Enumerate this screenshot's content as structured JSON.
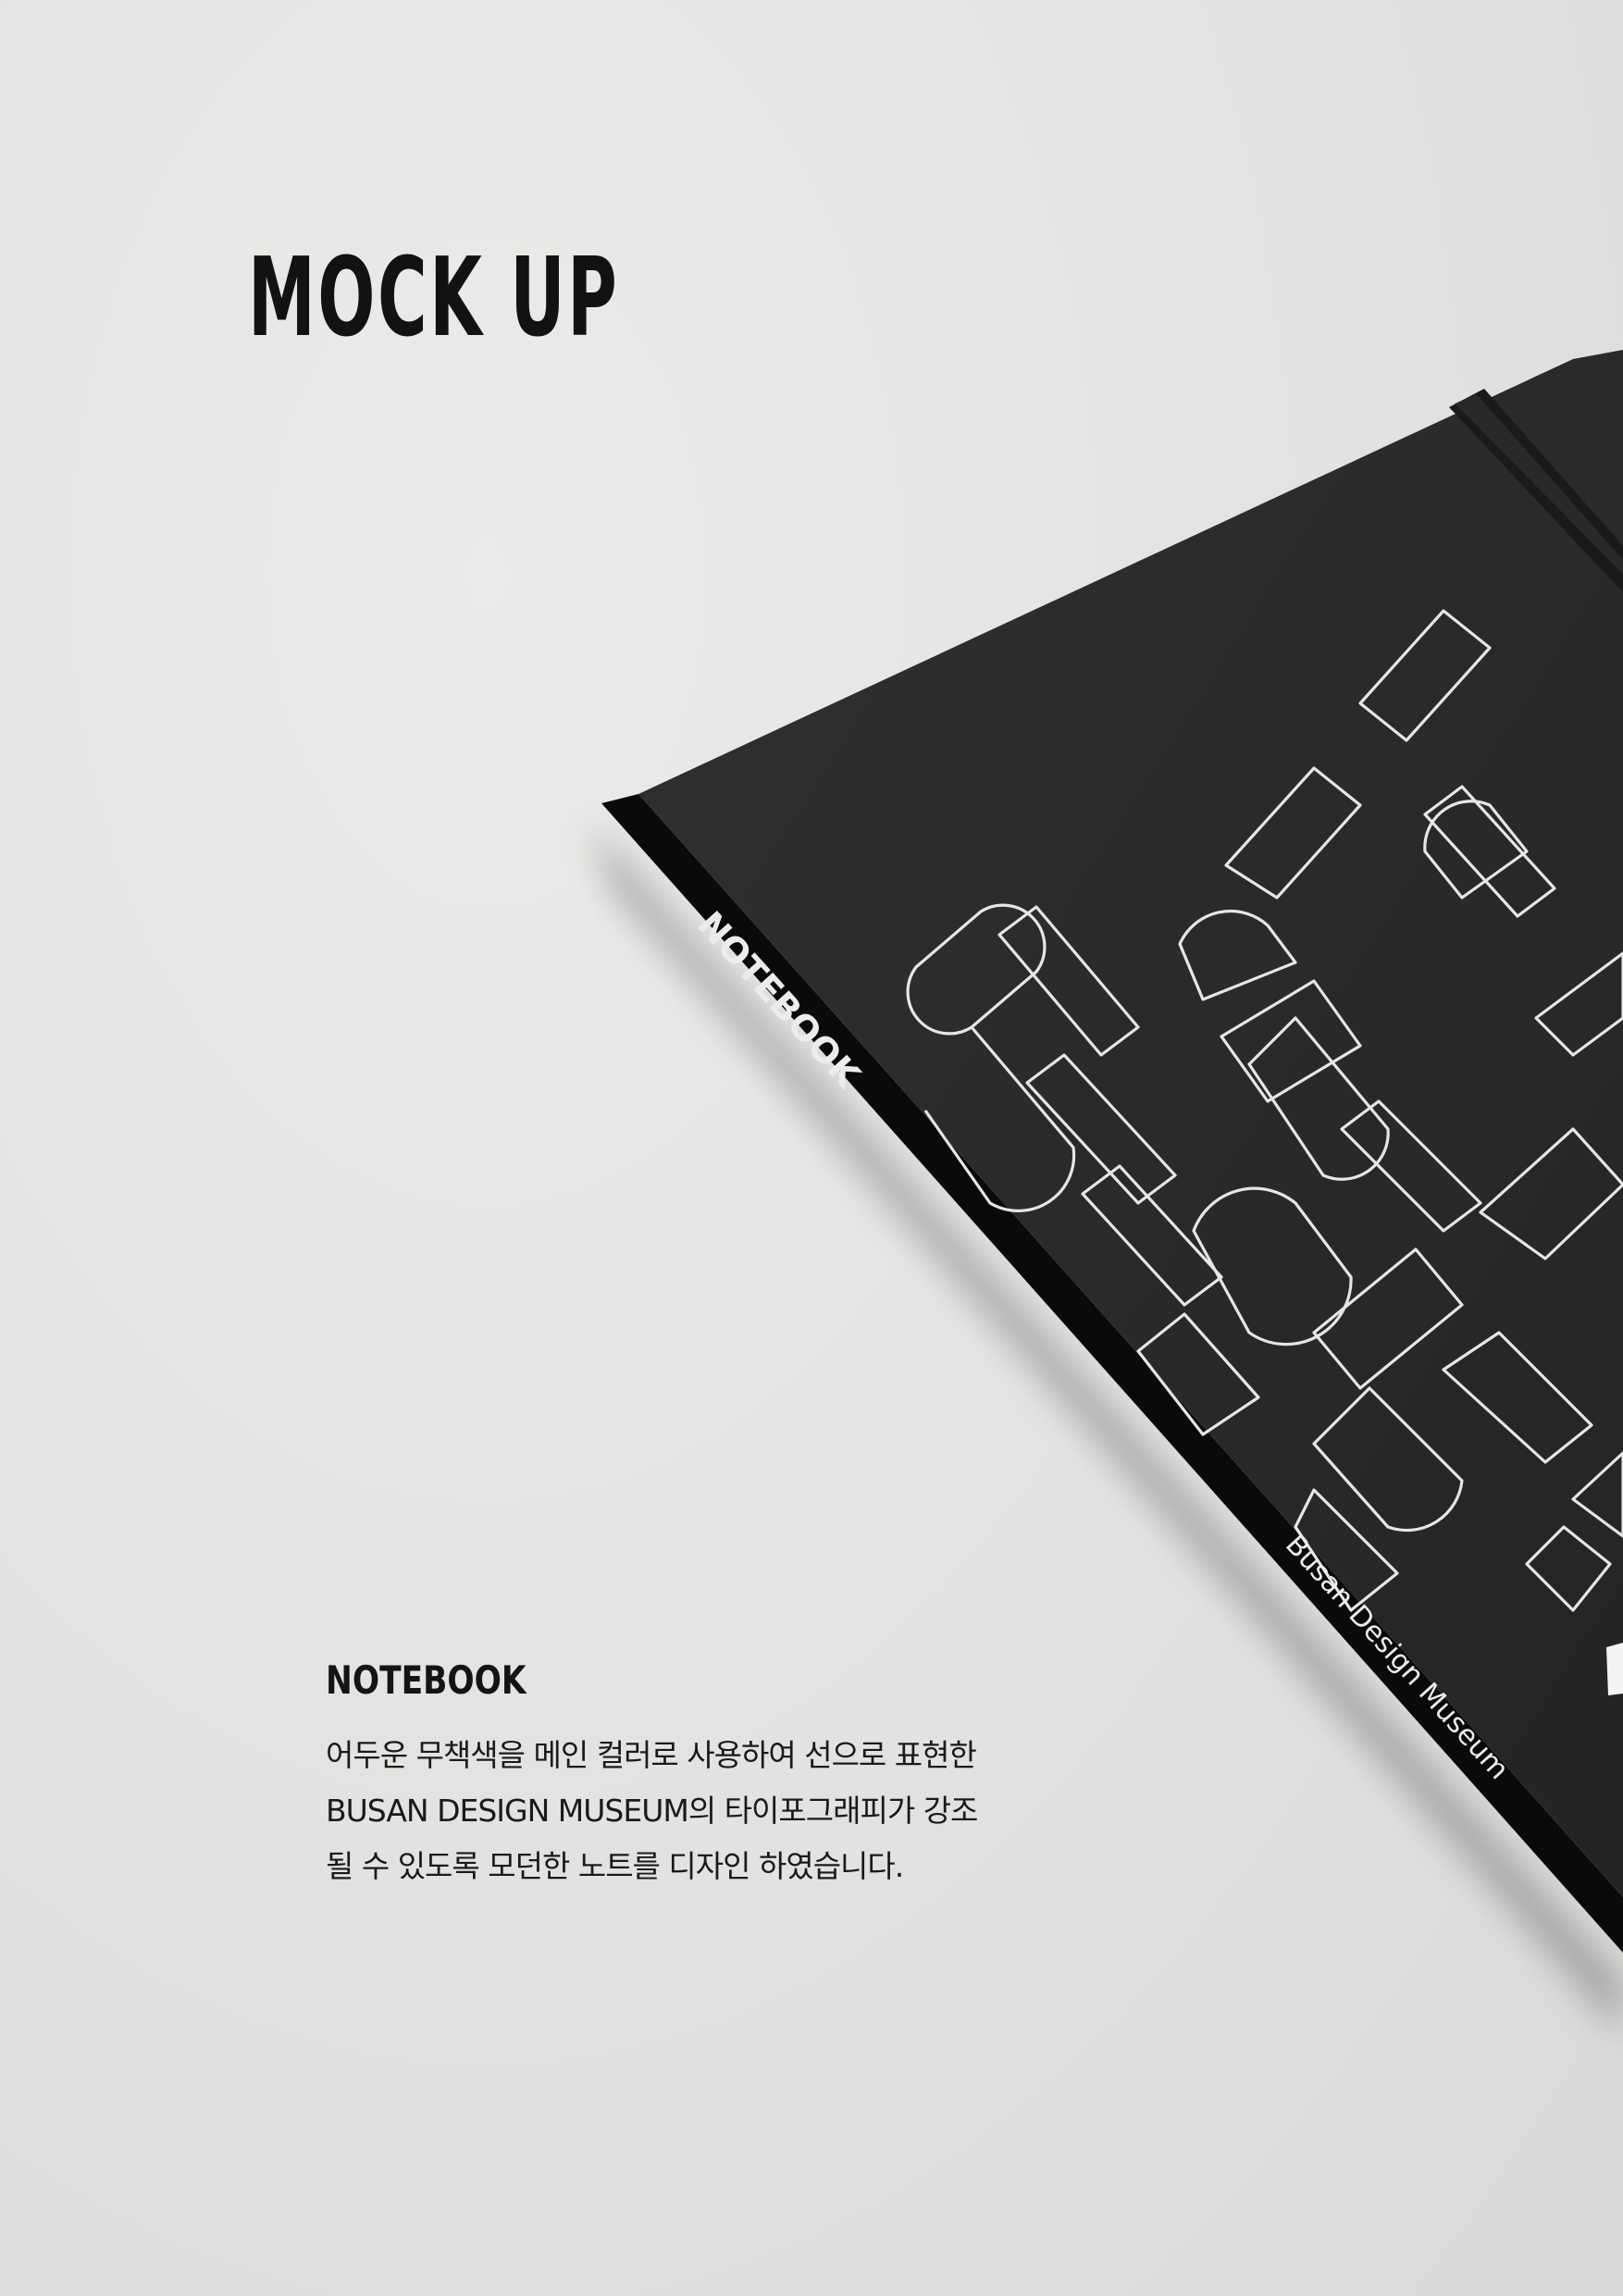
{
  "heading": {
    "title": "MOCK UP"
  },
  "notebook": {
    "spine_label": "NOTEBOOK",
    "spine_brand": "Busan Design Museum"
  },
  "caption": {
    "title": "NOTEBOOK",
    "lines": [
      "어두운 무책색을 메인 컬러로 사용하여 선으로 표현한",
      "BUSAN DESIGN MUSEUM의 타이포그래피가 강조",
      "될 수 있도록 모던한 노트를 디자인 하였습니다."
    ]
  },
  "colors": {
    "background": "#e2e2e0",
    "cover": "#2b2b2b",
    "spine": "#0a0a0a",
    "text": "#141414"
  }
}
